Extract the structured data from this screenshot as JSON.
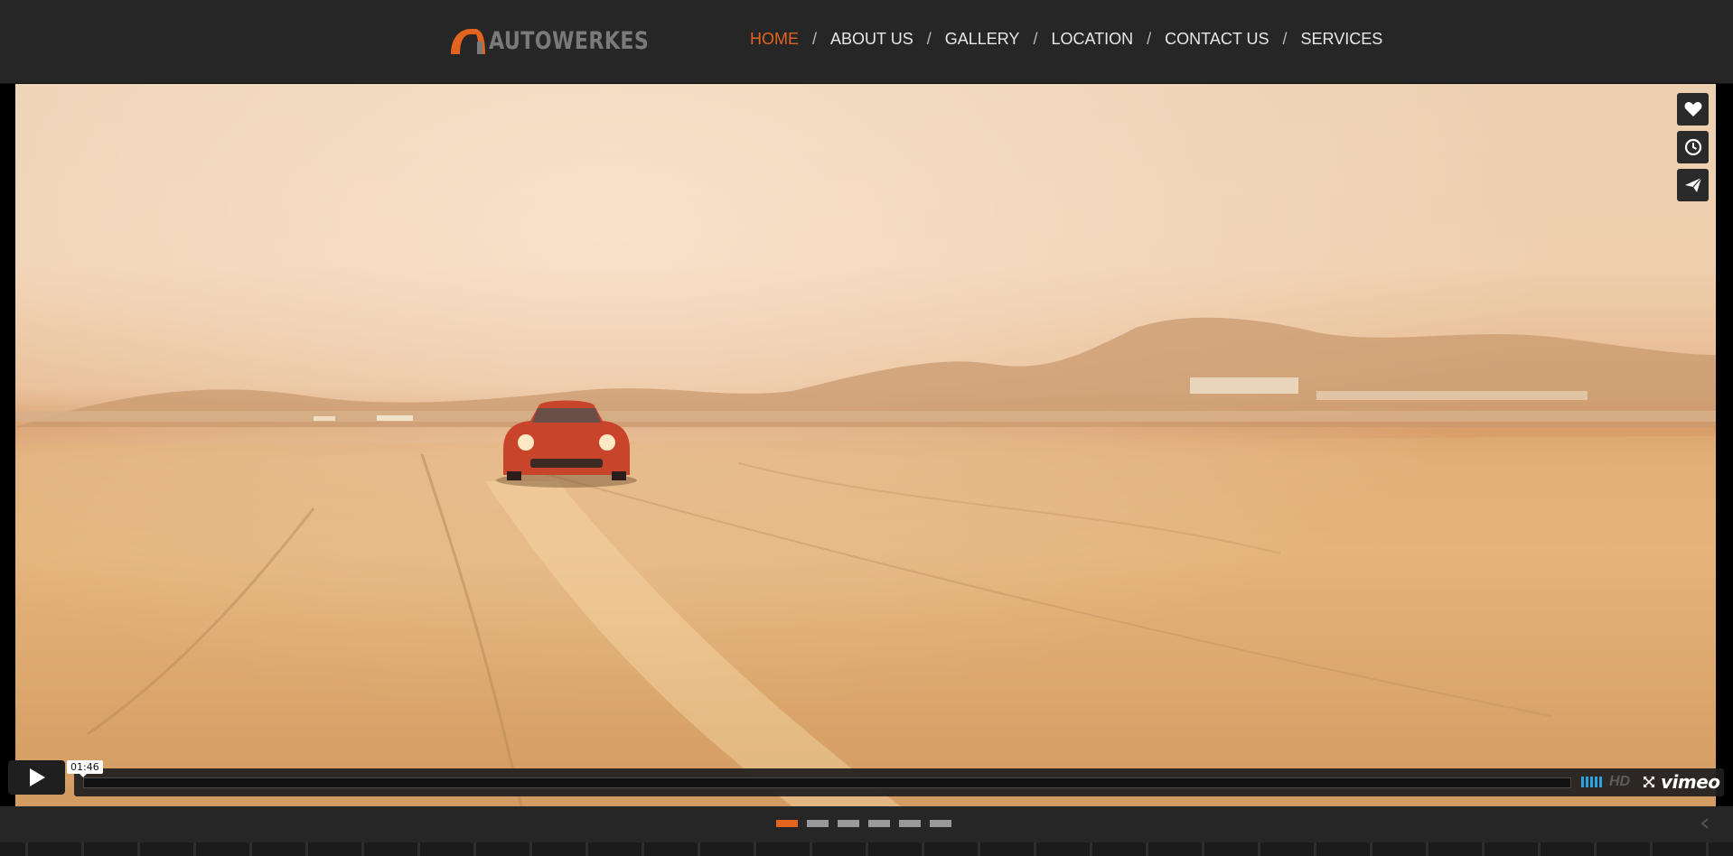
{
  "brand": {
    "name": "AUTOWERKES",
    "accent": "#e3641f"
  },
  "nav": {
    "items": [
      {
        "label": "HOME",
        "active": true
      },
      {
        "label": "ABOUT US"
      },
      {
        "label": "GALLERY"
      },
      {
        "label": "LOCATION"
      },
      {
        "label": "CONTACT US"
      },
      {
        "label": "SERVICES"
      }
    ],
    "separator": "/"
  },
  "video": {
    "timecode": "01:46",
    "progress": 0,
    "volume_icon": "volume-bars-icon",
    "hd_label": "HD",
    "player_brand": "vimeo",
    "side_buttons": [
      "heart-icon",
      "clock-icon",
      "paper-plane-icon"
    ]
  },
  "slider": {
    "slide_count": 6,
    "active_index": 0
  }
}
